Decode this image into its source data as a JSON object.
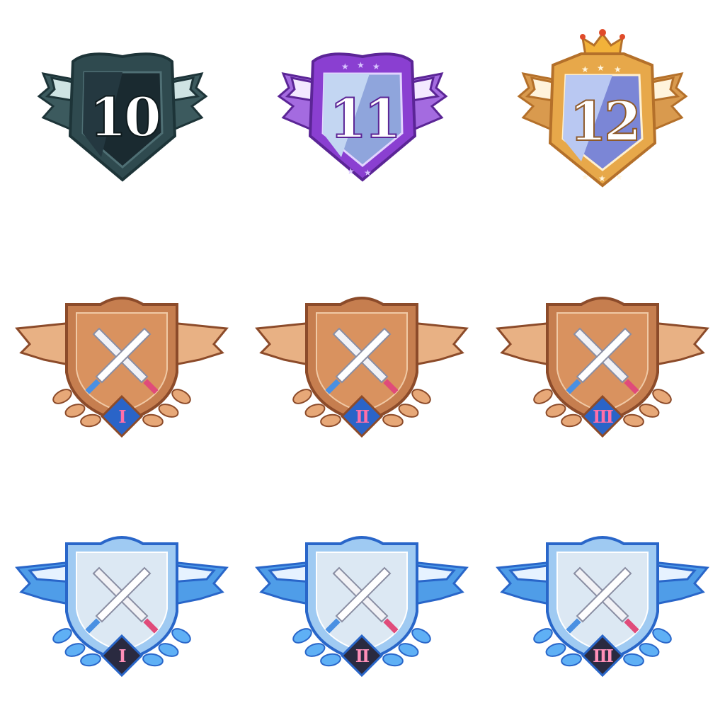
{
  "level_badges": [
    {
      "level": "10",
      "theme": "dark",
      "colors": {
        "frame": "#2f4a4f",
        "face": "#1a2a30",
        "wing": "#3c5a5e",
        "wing_light": "#cfe3e3",
        "outline": "#1d3438"
      }
    },
    {
      "level": "11",
      "theme": "purple",
      "colors": {
        "frame": "#8a3fd1",
        "face": "#8fa5dc",
        "wing": "#a46be0",
        "wing_light": "#f3e9ff",
        "outline": "#5b2596"
      }
    },
    {
      "level": "12",
      "theme": "gold",
      "colors": {
        "frame": "#e7a84a",
        "face": "#7b86d6",
        "wing": "#d99a4e",
        "wing_light": "#fff3dc",
        "outline": "#b4702a",
        "crown": "#f2b23a"
      }
    }
  ],
  "rank_rows": [
    {
      "tier": "bronze",
      "colors": {
        "shield": "#c67e4f",
        "shield_light": "#f0c9a5",
        "wing": "#e8b184",
        "laurel": "#e7a878",
        "outline": "#8c4b2a",
        "gem": "#2a64c8",
        "numeral": "#ff6fa8"
      },
      "ranks": [
        "I",
        "II",
        "III"
      ]
    },
    {
      "tier": "ice",
      "colors": {
        "shield": "#dce8f3",
        "shield_light": "#ffffff",
        "wing": "#4f9de8",
        "laurel": "#5fb0f5",
        "outline": "#2966c9",
        "gem": "#2a2a40",
        "numeral": "#ff8fb8"
      },
      "ranks": [
        "I",
        "II",
        "III"
      ]
    }
  ],
  "icons": {
    "emblem": "crossed-swords-icon",
    "crown": "crown-icon",
    "stars": "star-icon"
  }
}
